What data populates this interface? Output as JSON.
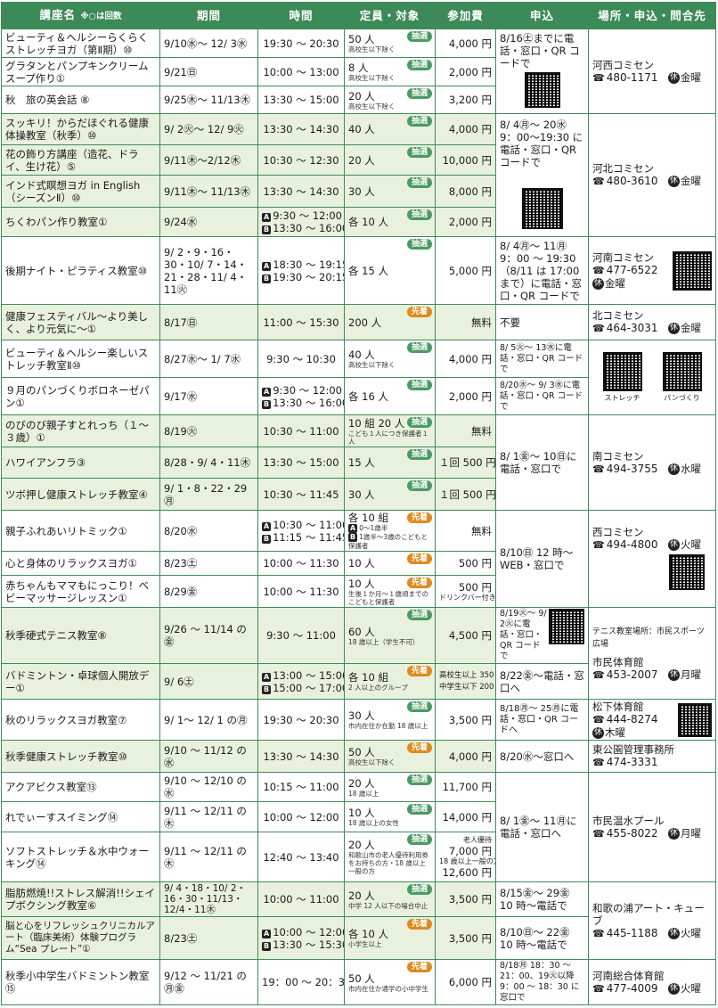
{
  "header": {
    "name": "講座名",
    "name_note": "※○は回数",
    "period": "期間",
    "time": "時間",
    "capacity": "定員・対象",
    "fee": "参加費",
    "apply": "申込",
    "place": "場所・申込・問合先"
  },
  "badges": {
    "lottery": "抽選",
    "first": "先着"
  },
  "rows": [
    {
      "name": "ビューティ＆ヘルシーらくらくストレッチヨガ（第Ⅱ期）⑩",
      "period": "9/10㊌〜 12/ 3㊌",
      "time": "19:30 〜 20:30",
      "cap": "50 人",
      "cap_sub": "高校生以下除く",
      "fee": "4,000 円"
    },
    {
      "name": "グラタンとパンプキンクリームスープ作り①",
      "period": "9/21㊐",
      "time": "10:00 〜 13:00",
      "cap": "8 人",
      "cap_sub": "高校生以下除く",
      "fee": "2,000 円"
    },
    {
      "name": "秋　旅の英会話 ⑧",
      "period": "9/25㊍〜 11/13㊍",
      "time": "13:30 〜 15:00",
      "cap": "20 人",
      "cap_sub": "高校生以下除く",
      "fee": "3,200 円"
    },
    {
      "name": "スッキリ！からだほぐれる健康体操教室（秋季）⑩",
      "period": "9/ 2㊋〜 12/ 9㊋",
      "time": "13:30 〜 14:30",
      "cap": "40 人",
      "fee": "4,000 円"
    },
    {
      "name": "花の飾り方講座（造花、ドライ、生け花）⑤",
      "period": "9/11㊍〜2/12㊍",
      "time": "10:30 〜 12:30",
      "cap": "20 人",
      "fee": "10,000 円"
    },
    {
      "name": "インド式瞑想ヨガ in English（シーズンⅡ）⑩",
      "period": "9/11㊍〜 11/13㊍",
      "time": "13:30 〜 14:30",
      "cap": "30 人",
      "fee": "8,000 円"
    },
    {
      "name": "ちくわパン作り教室①",
      "period": "9/24㊌",
      "time_a": "9:30 〜 12:00",
      "time_b": "13:30 〜 16:00",
      "cap": "各 10 人",
      "fee": "2,000 円"
    },
    {
      "name": "後期ナイト・ピラティス教室⑩",
      "period": "9/ 2・9・16・30・10/ 7・14・21・28・11/ 4・11㊋",
      "time_a": "18:30 〜 19:15",
      "time_b": "19:30 〜 20:15",
      "cap": "各 15 人",
      "fee": "5,000 円"
    },
    {
      "name": "健康フェスティバル〜より美しく、より元気に〜①",
      "period": "8/17㊐",
      "time": "11:00 〜 15:30",
      "cap": "200 人",
      "fee": "無料"
    },
    {
      "name": "ビューティ＆ヘルシー楽しいストレッチ教室Ⅱ⑩",
      "period": "8/27㊌〜 1/ 7㊌",
      "time": "9:30 〜 10:30",
      "cap": "40 人",
      "cap_sub": "高校生以下除く",
      "fee": "4,000 円"
    },
    {
      "name": "９月のパンづくりボロネーゼパン①",
      "period": "9/17㊌",
      "time_a": "9:30 〜 12:00",
      "time_b": "13:30 〜 16:00",
      "cap": "各 16 人",
      "fee": "2,000 円"
    },
    {
      "name": "のびのび親子すとれっち（１〜３歳）①",
      "period": "8/19㊋",
      "time": "10:30 〜 11:00",
      "cap": "10 組 20 人",
      "cap_sub": "こども１人につき保護者１人",
      "fee": "無料"
    },
    {
      "name": "ハワイアンフラ③",
      "period": "8/28・9/ 4・11㊍",
      "time": "13:30 〜 15:00",
      "cap": "15 人",
      "fee": "１回 500 円"
    },
    {
      "name": "ツボ押し健康ストレッチ教室④",
      "period": "9/ 1・8・22・29㊊",
      "time": "10:30 〜 11:45",
      "cap": "30 人",
      "fee": "１回 500 円"
    },
    {
      "name": "親子ふれあいリトミック①",
      "period": "8/20㊌",
      "time_a": "10:30 〜 11:00",
      "time_b": "11:15 〜 11:45",
      "cap": "各 10 組",
      "cap_sub": "0〜1歳半",
      "cap_sub2": "1歳半〜3歳のこどもと保護者",
      "fee": "無料"
    },
    {
      "name": "心と身体のリラックスヨガ①",
      "period": "8/23㊏",
      "time": "10:00 〜 11:30",
      "cap": "10 人",
      "fee": "500 円"
    },
    {
      "name": "赤ちゃんもママもにっこり！ベビーマッサージレッスン①",
      "period": "8/29㊎",
      "time": "10:00 〜 11:30",
      "cap": "10 人",
      "cap_sub": "生後１か月〜１歳頃までのこどもと保護者",
      "fee": "500 円",
      "fee_sub": "ドリンクバー付き"
    },
    {
      "name": "秋季硬式テニス教室⑧",
      "period": "9/26 〜 11/14 の㊎",
      "time": "9:30 〜 11:00",
      "cap": "60 人",
      "cap_sub": "18 歳以上（学生不可）",
      "fee": "4,500 円"
    },
    {
      "name": "バドミントン・卓球個人開放デー①",
      "period": "9/ 6㊏",
      "time_a": "13:00 〜 15:00",
      "time_b": "15:00 〜 17:00",
      "cap": "各 10 組",
      "cap_sub": "2 人以上のグループ",
      "fee_sub": "高校生以上 350 円",
      "fee_sub2": "中学生以下 200 円"
    },
    {
      "name": "秋のリラックスヨガ教室⑦",
      "period": "9/ 1〜 12/ 1 の㊊",
      "time": "19:30 〜 20:30",
      "cap": "30 人",
      "cap_sub": "市内在住か在勤 18 歳以上",
      "fee": "3,500 円"
    },
    {
      "name": "秋季健康ストレッチ教室⑩",
      "period": "9/10 〜 11/12 の㊌",
      "time": "13:30 〜 14:30",
      "cap": "50 人",
      "cap_sub": "高校生以下除く",
      "fee": "4,000 円"
    },
    {
      "name": "アクアビクス教室⑬",
      "period": "9/10 〜 12/10 の㊌",
      "time": "10:15 〜 11:00",
      "cap": "20 人",
      "cap_sub": "18 歳以上",
      "fee": "11,700 円"
    },
    {
      "name": "れでぃーすスイミング⑭",
      "period": "9/11 〜 12/11 の㊍",
      "time": "10:00 〜 12:00",
      "cap": "10 人",
      "cap_sub": "18 歳以上の女性",
      "fee": "14,000 円"
    },
    {
      "name": "ソフトストレッチ＆水中ウォーキング⑭",
      "period": "9/11 〜 12/11 の㊍",
      "time": "12:40 〜 13:40",
      "cap": "20 人",
      "cap_sub": "和歌山市の老人優待利用券をお持ちの方・18 歳以上一般の方",
      "fee_top": "老人優待",
      "fee": "7,000 円",
      "fee_mid": "18 歳以上一般の方",
      "fee2": "12,600 円"
    },
    {
      "name": "脂肪燃焼!!ストレス解消!!シェイプボクシング教室⑥",
      "period": "9/ 4・18・10/ 2・16・30・11/13・12/4・11㊍",
      "time": "10:00 〜 11:00",
      "cap": "20 人",
      "cap_sub": "中学 12 人以下の場合中止",
      "fee": "3,500 円"
    },
    {
      "name": "脳と心をリフレッシュクリニカルアート（臨床美術）体験プログラム“Sea プレート”①",
      "period": "8/23㊏",
      "time_a": "10:00 〜 12:00",
      "time_b": "13:30 〜 15:30",
      "cap": "各 10 人",
      "cap_sub": "小学生以上",
      "fee": "3,500 円"
    },
    {
      "name": "秋季小中学生バドミントン教室⑮",
      "period": "9/12 〜 11/21 の㊊㊎",
      "time": "19：00 〜 20：30",
      "cap": "50 人",
      "cap_sub": "市内在住か通学の小中学生",
      "fee": "6,000 円"
    }
  ],
  "apply": [
    "8/16㊏までに電話・窓口・QR コードで",
    "8/ 4㊊〜 20㊌ 9：00〜19:30 に電話・窓口・QR コードで",
    "8/ 4㊊〜 11㊊ 9：00 〜 19:30（8/11 は 17:00 まで）に電話・窓口・QR コードで",
    "不要",
    "8/ 5㊋〜 13㊌に電話・窓口・QR コードで",
    "8/20㊌〜 9/ 3㊌に電話・窓口・QR コードで",
    "8/ 1㊎〜 10㊐に電話・窓口で",
    "8/10㊐ 12 時〜 WEB・窓口で",
    "8/19㊋〜 9/ 2㊋に電話・窓口・QR コードで",
    "8/22㊎〜電話・窓口へ",
    "8/18㊊〜 25㊊に電話・窓口・QR コードへ",
    "8/20㊌〜窓口へ",
    "8/ 1㊎〜 11㊊に電話・窓口へ",
    "8/15㊎〜 29㊎ 10 時〜電話で",
    "8/10㊐〜 22㊎ 10 時〜電話で",
    "8/18㊊ 18：30 〜 21：00、19㊋以降 9：00 〜 18：30 に窓口で"
  ],
  "places": [
    {
      "name": "河西コミセン",
      "tel": "480-1171",
      "closed": "金曜"
    },
    {
      "name": "河北コミセン",
      "tel": "480-3610",
      "closed": "金曜"
    },
    {
      "name": "河南コミセン",
      "tel": "477-6522",
      "closed": "金曜"
    },
    {
      "name": "北コミセン",
      "tel": "464-3031",
      "closed": "金曜"
    },
    {
      "name": "南コミセン",
      "tel": "494-3755",
      "closed": "水曜"
    },
    {
      "name": "西コミセン",
      "tel": "494-4800",
      "closed": "火曜"
    },
    {
      "name": "市民体育館",
      "tel": "453-2007",
      "closed": "月曜",
      "note": "テニス教室場所：市民スポーツ広場"
    },
    {
      "name": "松下体育館",
      "tel": "444-8274",
      "closed": "木曜"
    },
    {
      "name": "東公園管理事務所",
      "tel": "474-3331"
    },
    {
      "name": "市民温水プール",
      "tel": "455-8022",
      "closed": "月曜"
    },
    {
      "name": "和歌の浦アート・キューブ",
      "tel": "445-1188",
      "closed": "火曜"
    },
    {
      "name": "河南総合体育館",
      "tel": "477-4009",
      "closed": "火曜"
    }
  ],
  "labels": {
    "qr_stretch": "ストレッチ",
    "qr_bread": "パンづくり",
    "closed_icon": "休",
    "ab_a": "A",
    "ab_b": "B",
    "ab_ab": "AB"
  },
  "colors": {
    "header": "#3b8a57",
    "alt_row": "#e8f1dd",
    "border": "#3f8a5a",
    "lottery": "#4b9a63",
    "first_come": "#e08a1c"
  }
}
